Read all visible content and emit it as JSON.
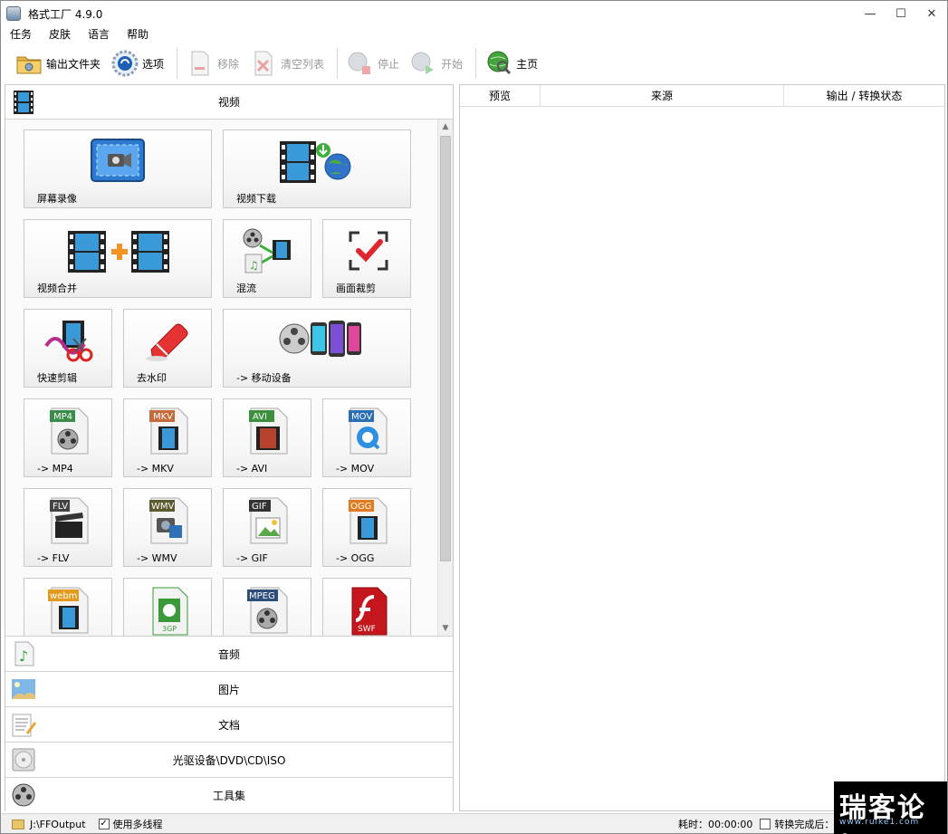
{
  "window": {
    "title": "格式工厂 4.9.0"
  },
  "window_controls": {
    "minimize": "—",
    "maximize": "☐",
    "close": "✕"
  },
  "menu": [
    "任务",
    "皮肤",
    "语言",
    "帮助"
  ],
  "toolbar": {
    "output_folder": "输出文件夹",
    "options": "选项",
    "remove": "移除",
    "clear_list": "清空列表",
    "stop": "停止",
    "start": "开始",
    "home": "主页"
  },
  "categories": {
    "video": "视频",
    "audio": "音频",
    "image": "图片",
    "document": "文档",
    "optical": "光驱设备\\DVD\\CD\\ISO",
    "tools": "工具集"
  },
  "video_tiles": [
    "屏幕录像",
    "视频下载",
    "视频合并",
    "混流",
    "画面裁剪",
    "快速剪辑",
    "去水印",
    "-> 移动设备",
    "-> MP4",
    "-> MKV",
    "-> AVI",
    "-> MOV",
    "-> FLV",
    "-> WMV",
    "-> GIF",
    "-> OGG",
    "",
    "",
    "",
    ""
  ],
  "format_badges": [
    "MP4",
    "MKV",
    "AVI",
    "MOV",
    "FLV",
    "WMV",
    "GIF",
    "OGG",
    "webm",
    "3GP",
    "MPEG",
    "SWF"
  ],
  "task_list": {
    "columns": [
      "预览",
      "来源",
      "输出 / 转换状态"
    ]
  },
  "status": {
    "output_path": "J:\\FFOutput",
    "multithread_label": "使用多线程",
    "multithread_checked": true,
    "elapsed": "耗时：00:00:00",
    "after_convert": "转换完成后：关闭"
  },
  "watermark": {
    "main": "瑞客论坛",
    "sub": "www.ruike1.com"
  }
}
